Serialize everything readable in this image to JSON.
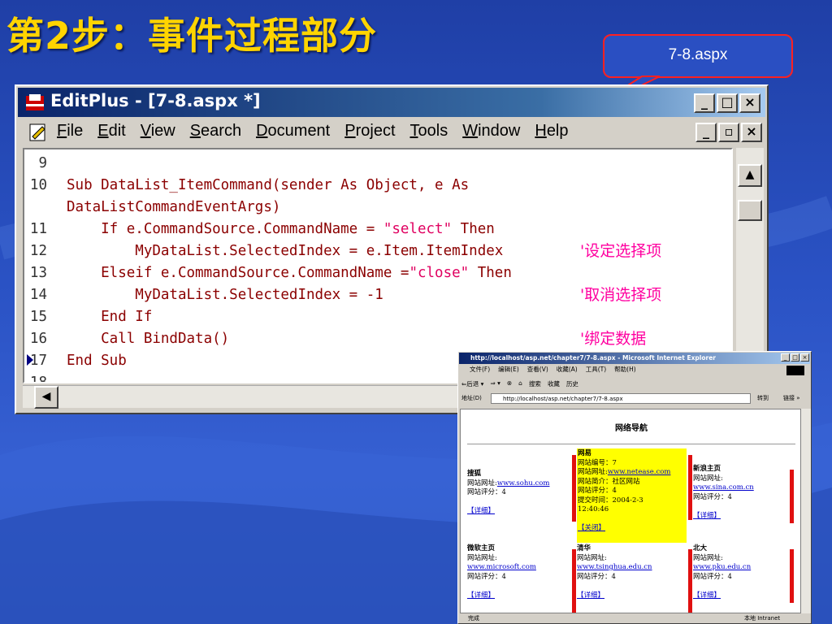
{
  "slide": {
    "title": "第2步：事件过程部分",
    "callout": "7-8.aspx"
  },
  "editplus": {
    "title": "EditPlus - [7-8.aspx *]",
    "controls": [
      "_",
      "□",
      "×"
    ],
    "menu": [
      "File",
      "Edit",
      "View",
      "Search",
      "Document",
      "Project",
      "Tools",
      "Window",
      "Help"
    ],
    "lines": [
      {
        "n": "9",
        "code": ""
      },
      {
        "n": "10",
        "code": "Sub DataList_ItemCommand(sender As Object, e As"
      },
      {
        "n": "",
        "code": "DataListCommandEventArgs)"
      },
      {
        "n": "11",
        "pre": "    If e.CommandSource.CommandName = ",
        "str": "\"select\"",
        "post": " Then"
      },
      {
        "n": "12",
        "code": "        MyDataList.SelectedIndex = e.Item.ItemIndex",
        "cmt": "'设定选择项"
      },
      {
        "n": "13",
        "pre": "    Elseif e.CommandSource.CommandName =",
        "str": "\"close\"",
        "post": " Then"
      },
      {
        "n": "14",
        "code": "        MyDataList.SelectedIndex = -1",
        "cmt": "'取消选择项"
      },
      {
        "n": "15",
        "code": "    End If"
      },
      {
        "n": "16",
        "code": "    Call BindData()",
        "cmt": "'绑定数据"
      },
      {
        "n": "17",
        "code": "End Sub"
      },
      {
        "n": "18",
        "code": ""
      }
    ]
  },
  "ie": {
    "title": "http://localhost/asp.net/chapter7/7-8.aspx - Microsoft Internet Explorer",
    "menu": [
      "文件(F)",
      "编辑(E)",
      "查看(V)",
      "收藏(A)",
      "工具(T)",
      "帮助(H)"
    ],
    "toolbar": [
      "⇐后退 ▾",
      "⇒ ▾",
      "⊗",
      "⌂",
      "搜索",
      "收藏",
      "历史"
    ],
    "address_label": "地址(D)",
    "address": "http://localhost/asp.net/chapter7/7-8.aspx",
    "go": "转到",
    "links": "链接 »",
    "status_left": "完成",
    "status_right": "本地 Intranet",
    "page": {
      "heading": "网络导航",
      "detail_link": "【详细】",
      "close_link": "【关闭】",
      "sites": [
        {
          "name": "搜狐",
          "url_label": "网站网址:",
          "url": "www.sohu.com",
          "rating": "网站评分：4"
        },
        {
          "name": "网易",
          "id": "网站编号：7",
          "url_label": "网站网址:",
          "url": "www.netease.com",
          "desc": "网站简介：社区网站",
          "rating": "网站评分：4",
          "time": "提交时间：2004-2-3",
          "time2": "12:40:46"
        },
        {
          "name": "新浪主页",
          "url_label": "网站网址:",
          "url": "www.sina.com.cn",
          "rating": "网站评分：4"
        },
        {
          "name": "微软主页",
          "url_label": "网站网址:",
          "url": "www.microsoft.com",
          "rating": "网站评分：4"
        },
        {
          "name": "清华",
          "url_label": "网站网址:",
          "url": "www.tsinghua.edu.cn",
          "rating": "网站评分：4"
        },
        {
          "name": "北大",
          "url_label": "网站网址:",
          "url": "www.pku.edu.cn",
          "rating": "网站评分：4"
        }
      ]
    }
  }
}
